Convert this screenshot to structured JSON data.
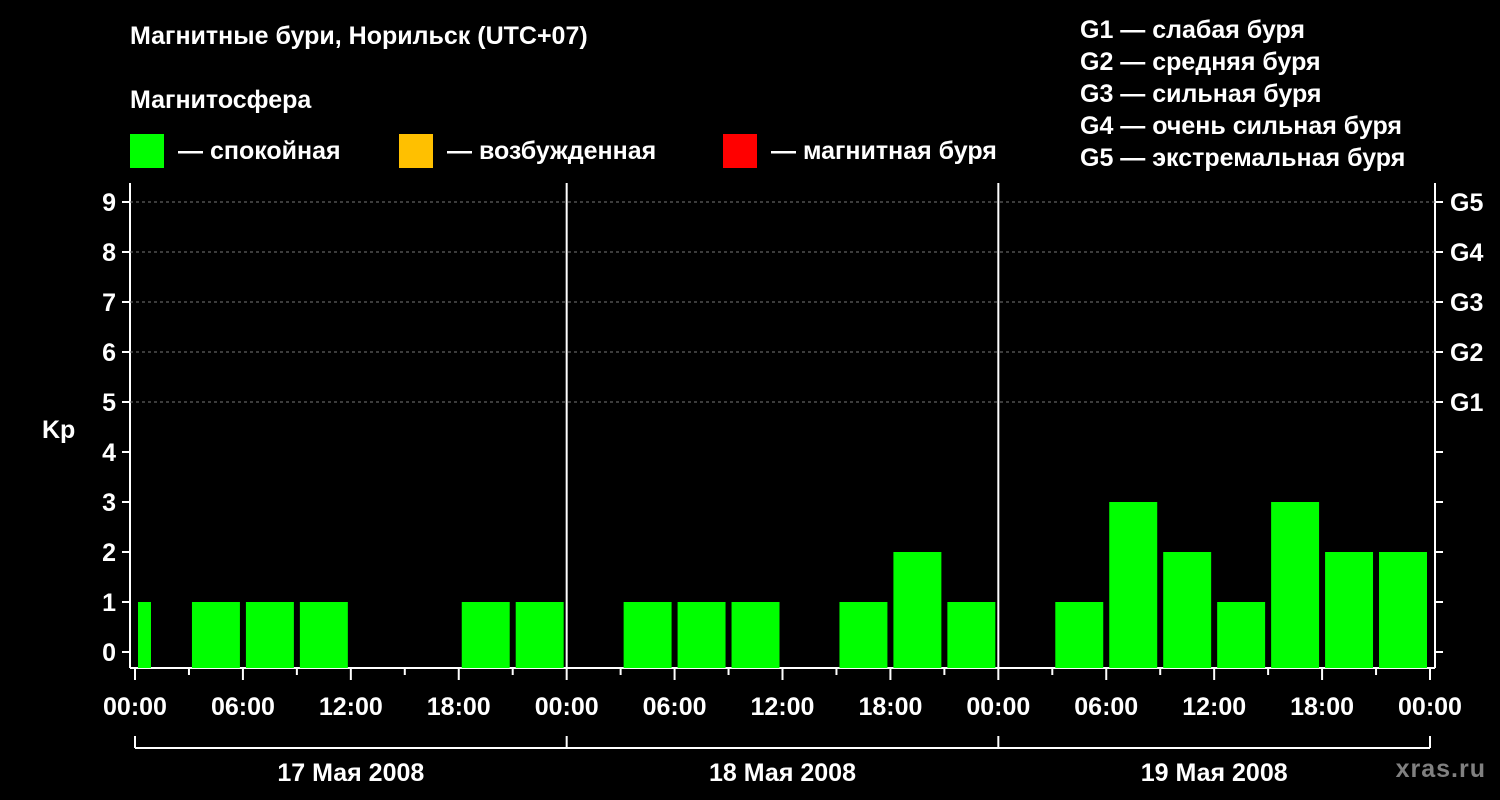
{
  "chart_data": {
    "type": "bar",
    "title": "Магнитные бури, Норильск (UTC+07)",
    "subtitle": "Магнитосфера",
    "ylabel": "Kp",
    "ylim": [
      0,
      9
    ],
    "yticks": [
      "0",
      "1",
      "2",
      "3",
      "4",
      "5",
      "6",
      "7",
      "8",
      "9"
    ],
    "right_axis_labels": [
      {
        "kp": 5,
        "label": "G1"
      },
      {
        "kp": 6,
        "label": "G2"
      },
      {
        "kp": 7,
        "label": "G3"
      },
      {
        "kp": 8,
        "label": "G4"
      },
      {
        "kp": 9,
        "label": "G5"
      }
    ],
    "xtick_labels": [
      "00:00",
      "06:00",
      "12:00",
      "18:00",
      "00:00",
      "06:00",
      "12:00",
      "18:00",
      "00:00",
      "06:00",
      "12:00",
      "18:00",
      "00:00"
    ],
    "days": [
      "17 Мая 2008",
      "18 Мая 2008",
      "19 Мая 2008"
    ],
    "grid": "dashed horizontal at 5–9",
    "status_legend": [
      {
        "label": "— спокойная",
        "color": "#00ff00"
      },
      {
        "label": "— возбужденная",
        "color": "#ffc000"
      },
      {
        "label": "— магнитная буря",
        "color": "#ff0000"
      }
    ],
    "storm_scale": [
      "G1 — слабая буря",
      "G2 — средняя буря",
      "G3 — сильная буря",
      "G4 — очень сильная буря",
      "G5 — экстремальная буря"
    ],
    "series": [
      {
        "color": "#00ff00",
        "values": [
          1,
          1,
          1,
          1,
          null,
          null,
          1,
          1,
          null,
          1,
          1,
          1,
          null,
          1,
          2,
          1,
          null,
          1,
          3,
          2,
          1,
          3,
          2,
          2
        ]
      }
    ],
    "bar_interval_hours": 3,
    "first_bar_partial": true
  },
  "watermark": "xras.ru"
}
